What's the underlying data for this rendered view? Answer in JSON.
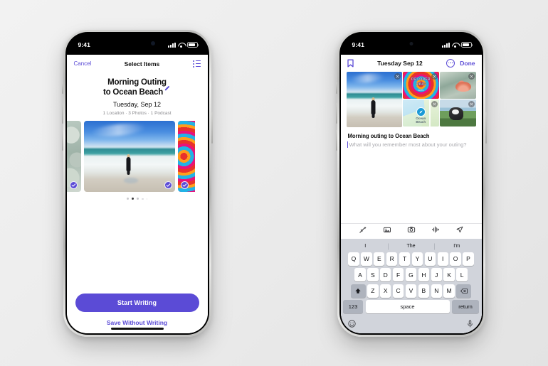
{
  "background": {
    "color_start": "#f2f2f2",
    "color_end": "#e3e3e3"
  },
  "theme": {
    "accent_purple": "#5B4BD6",
    "text_primary": "#111111",
    "text_muted": "#8A8A8E"
  },
  "left_phone": {
    "status_bar": {
      "time": "9:41",
      "signal_icon": "cellular-bars-icon",
      "wifi_icon": "wifi-icon",
      "battery_icon": "battery-icon"
    },
    "nav": {
      "cancel_label": "Cancel",
      "title": "Select Items",
      "list_icon": "list-bullet-icon"
    },
    "header": {
      "title_line1": "Morning Outing",
      "title_line2": "to Ocean Beach",
      "edit_icon": "pencil-icon",
      "date": "Tuesday, Sep 12",
      "meta": "1 Location · 3 Photos · 1 Podcast"
    },
    "carousel": {
      "items": [
        {
          "name": "rocks-photo",
          "selected": true
        },
        {
          "name": "beach-surfer-photo",
          "selected": true
        },
        {
          "name": "decoder-ring-podcast-art",
          "selected": true
        }
      ],
      "page_count": 5,
      "active_page": 2
    },
    "actions": {
      "primary_label": "Start Writing",
      "secondary_label": "Save Without Writing"
    }
  },
  "right_phone": {
    "status_bar": {
      "time": "9:41",
      "signal_icon": "cellular-bars-icon",
      "wifi_icon": "wifi-icon",
      "battery_icon": "battery-icon"
    },
    "nav": {
      "bookmark_icon": "bookmark-icon",
      "title": "Tuesday Sep 12",
      "more_icon": "ellipsis-circle-icon",
      "done_label": "Done"
    },
    "media": {
      "items": [
        {
          "name": "beach-surfer-photo",
          "label": "",
          "remove_icon": "close-icon"
        },
        {
          "name": "decoder-ring-podcast-art",
          "label": "DECODER",
          "label2": "RING",
          "label3": "SLATE",
          "remove_icon": "close-icon"
        },
        {
          "name": "seashell-photo",
          "label": "",
          "remove_icon": "close-icon"
        },
        {
          "name": "ocean-beach-map",
          "label": "Ocean Beach",
          "remove_icon": "close-icon"
        },
        {
          "name": "dog-on-trail-photo",
          "label": "",
          "remove_icon": "close-icon"
        }
      ]
    },
    "note": {
      "title": "Morning outing to Ocean Beach",
      "placeholder": "What will you remember most about your outing?"
    },
    "toolbar": {
      "items": [
        {
          "name": "magic-wand-icon"
        },
        {
          "name": "photo-library-icon"
        },
        {
          "name": "camera-icon"
        },
        {
          "name": "audio-waveform-icon"
        },
        {
          "name": "send-arrow-icon"
        }
      ]
    },
    "keyboard": {
      "predictions": [
        "I",
        "The",
        "I'm"
      ],
      "row1": [
        "Q",
        "W",
        "E",
        "R",
        "T",
        "Y",
        "U",
        "I",
        "O",
        "P"
      ],
      "row2": [
        "A",
        "S",
        "D",
        "F",
        "G",
        "H",
        "J",
        "K",
        "L"
      ],
      "row3": [
        "Z",
        "X",
        "C",
        "V",
        "B",
        "N",
        "M"
      ],
      "shift_icon": "shift-icon",
      "backspace_icon": "backspace-icon",
      "numeric_label": "123",
      "space_label": "space",
      "return_label": "return",
      "emoji_icon": "emoji-smiley-icon",
      "mic_icon": "microphone-icon"
    }
  }
}
